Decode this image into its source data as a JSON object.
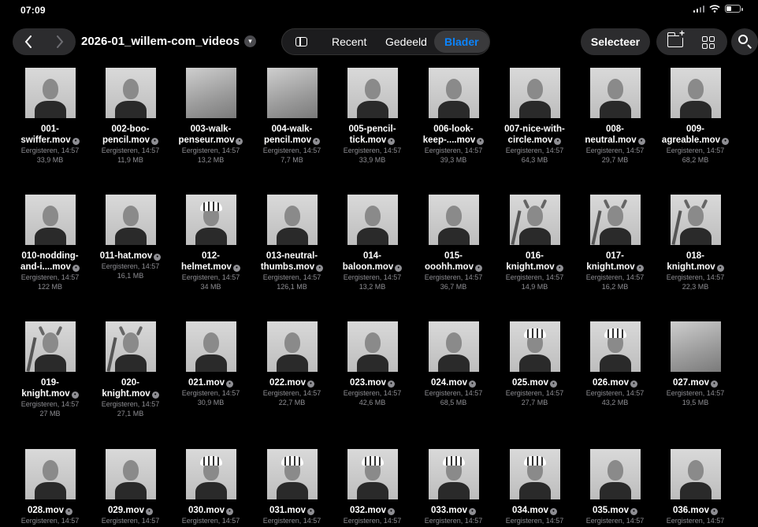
{
  "status": {
    "time": "07:09"
  },
  "toolbar": {
    "back_icon": "chevron-left-icon",
    "forward_icon": "chevron-right-icon",
    "folder_title": "2026-01_willem-com_videos",
    "tabs": {
      "recent": "Recent",
      "shared": "Gedeeld",
      "browse": "Blader"
    },
    "select_label": "Selecteer",
    "accent": "#0a84ff"
  },
  "files": [
    {
      "name1": "001-",
      "name2": "swiffer.mov",
      "date": "Eergisteren, 14:57",
      "size": "33,9 MB",
      "style": "plain"
    },
    {
      "name1": "002-boo-",
      "name2": "pencil.mov",
      "date": "Eergisteren, 14:57",
      "size": "11,9 MB",
      "style": "plain"
    },
    {
      "name1": "003-walk-",
      "name2": "penseur.mov",
      "date": "Eergisteren, 14:57",
      "size": "13,2 MB",
      "style": "blur"
    },
    {
      "name1": "004-walk-",
      "name2": "pencil.mov",
      "date": "Eergisteren, 14:57",
      "size": "7,7 MB",
      "style": "blur"
    },
    {
      "name1": "005-pencil-",
      "name2": "tick.mov",
      "date": "Eergisteren, 14:57",
      "size": "33,9 MB",
      "style": "plain"
    },
    {
      "name1": "006-look-",
      "name2": "keep-....mov",
      "date": "Eergisteren, 14:57",
      "size": "39,3 MB",
      "style": "plain"
    },
    {
      "name1": "007-nice-with-",
      "name2": "circle.mov",
      "date": "Eergisteren, 14:57",
      "size": "64,3 MB",
      "style": "plain"
    },
    {
      "name1": "008-",
      "name2": "neutral.mov",
      "date": "Eergisteren, 14:57",
      "size": "29,7 MB",
      "style": "plain"
    },
    {
      "name1": "009-",
      "name2": "agreable.mov",
      "date": "Eergisteren, 14:57",
      "size": "68,2 MB",
      "style": "plain"
    },
    {
      "name1": "010-nodding-",
      "name2": "and-i....mov",
      "date": "Eergisteren, 14:57",
      "size": "122 MB",
      "style": "plain"
    },
    {
      "name1": "",
      "name2": "011-hat.mov",
      "date": "Eergisteren, 14:57",
      "size": "16,1 MB",
      "style": "plain"
    },
    {
      "name1": "012-",
      "name2": "helmet.mov",
      "date": "Eergisteren, 14:57",
      "size": "34 MB",
      "style": "helmet"
    },
    {
      "name1": "013-neutral-",
      "name2": "thumbs.mov",
      "date": "Eergisteren, 14:57",
      "size": "126,1 MB",
      "style": "plain"
    },
    {
      "name1": "014-",
      "name2": "baloon.mov",
      "date": "Eergisteren, 14:57",
      "size": "13,2 MB",
      "style": "plain"
    },
    {
      "name1": "015-",
      "name2": "ooohh.mov",
      "date": "Eergisteren, 14:57",
      "size": "36,7 MB",
      "style": "plain"
    },
    {
      "name1": "016-",
      "name2": "knight.mov",
      "date": "Eergisteren, 14:57",
      "size": "14,9 MB",
      "style": "knight"
    },
    {
      "name1": "017-",
      "name2": "knight.mov",
      "date": "Eergisteren, 14:57",
      "size": "16,2 MB",
      "style": "knight"
    },
    {
      "name1": "018-",
      "name2": "knight.mov",
      "date": "Eergisteren, 14:57",
      "size": "22,3 MB",
      "style": "knight"
    },
    {
      "name1": "019-",
      "name2": "knight.mov",
      "date": "Eergisteren, 14:57",
      "size": "27 MB",
      "style": "knight"
    },
    {
      "name1": "020-",
      "name2": "knight.mov",
      "date": "Eergisteren, 14:57",
      "size": "27,1 MB",
      "style": "knight"
    },
    {
      "name1": "",
      "name2": "021.mov",
      "date": "Eergisteren, 14:57",
      "size": "30,9 MB",
      "style": "plain"
    },
    {
      "name1": "",
      "name2": "022.mov",
      "date": "Eergisteren, 14:57",
      "size": "22,7 MB",
      "style": "plain"
    },
    {
      "name1": "",
      "name2": "023.mov",
      "date": "Eergisteren, 14:57",
      "size": "42,6 MB",
      "style": "plain"
    },
    {
      "name1": "",
      "name2": "024.mov",
      "date": "Eergisteren, 14:57",
      "size": "68,5 MB",
      "style": "plain"
    },
    {
      "name1": "",
      "name2": "025.mov",
      "date": "Eergisteren, 14:57",
      "size": "27,7 MB",
      "style": "helmet"
    },
    {
      "name1": "",
      "name2": "026.mov",
      "date": "Eergisteren, 14:57",
      "size": "43,2 MB",
      "style": "helmet"
    },
    {
      "name1": "",
      "name2": "027.mov",
      "date": "Eergisteren, 14:57",
      "size": "19,5 MB",
      "style": "blur"
    },
    {
      "name1": "",
      "name2": "028.mov",
      "date": "Eergisteren, 14:57",
      "size": "",
      "style": "plain"
    },
    {
      "name1": "",
      "name2": "029.mov",
      "date": "Eergisteren, 14:57",
      "size": "",
      "style": "plain"
    },
    {
      "name1": "",
      "name2": "030.mov",
      "date": "Eergisteren, 14:57",
      "size": "",
      "style": "helmet"
    },
    {
      "name1": "",
      "name2": "031.mov",
      "date": "Eergisteren, 14:57",
      "size": "",
      "style": "helmet"
    },
    {
      "name1": "",
      "name2": "032.mov",
      "date": "Eergisteren, 14:57",
      "size": "",
      "style": "helmet"
    },
    {
      "name1": "",
      "name2": "033.mov",
      "date": "Eergisteren, 14:57",
      "size": "",
      "style": "helmet"
    },
    {
      "name1": "",
      "name2": "034.mov",
      "date": "Eergisteren, 14:57",
      "size": "",
      "style": "helmet"
    },
    {
      "name1": "",
      "name2": "035.mov",
      "date": "Eergisteren, 14:57",
      "size": "",
      "style": "plain"
    },
    {
      "name1": "",
      "name2": "036.mov",
      "date": "Eergisteren, 14:57",
      "size": "",
      "style": "plain"
    }
  ]
}
